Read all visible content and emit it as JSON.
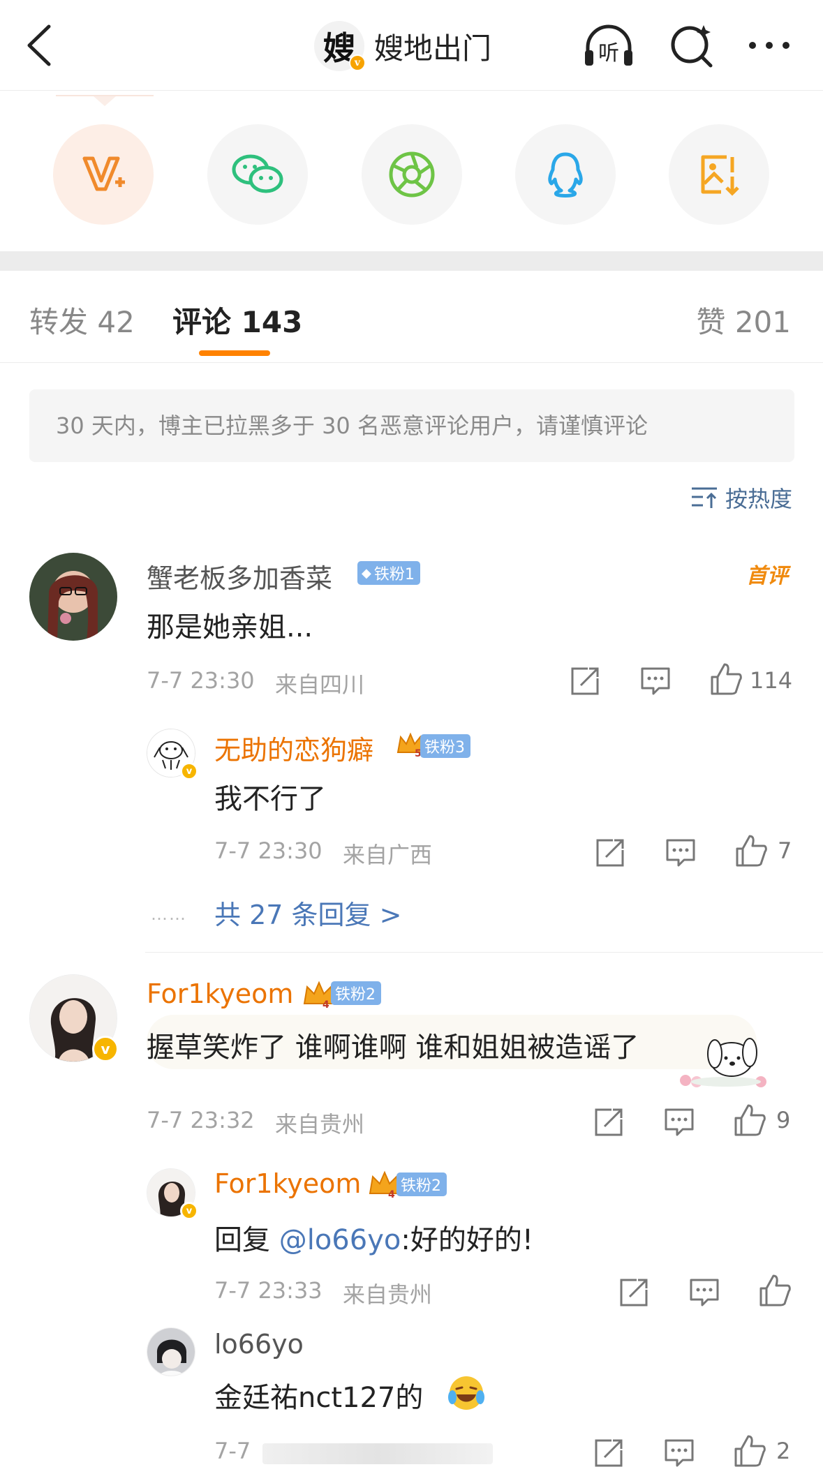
{
  "header": {
    "title": "嫂地出门",
    "avatar_glyph": "嫂",
    "verified_mark": "v",
    "icons": [
      "back-arrow-icon",
      "listen-icon",
      "search-icon",
      "more-icon"
    ],
    "listen_label": "听"
  },
  "share": {
    "items": [
      "v-plus-icon",
      "wechat-icon",
      "moments-icon",
      "qq-icon",
      "save-image-icon"
    ]
  },
  "tabs": {
    "repost": "转发 42",
    "comment": "评论 143",
    "like": "赞 201",
    "accent": "#ff8200"
  },
  "notice": "30 天内，博主已拉黑多于 30 名恶意评论用户，请谨慎评论",
  "sort_label": "按热度",
  "comments": [
    {
      "user": "蟹老板多加香菜",
      "badge": "铁粉1",
      "first_label": "首评",
      "text": "那是她亲姐...",
      "time": "7-7 23:30",
      "location": "来自四川",
      "likes": "114",
      "replies": [
        {
          "user": "无助的恋狗癖",
          "badge": "铁粉3",
          "crown_level": "5",
          "text": "我不行了",
          "time": "7-7 23:30",
          "location": "来自广西",
          "likes": "7"
        }
      ],
      "more_replies": "共 27 条回复 >",
      "dots": "……"
    },
    {
      "user": "For1kyeom",
      "badge": "铁粉2",
      "crown_level": "4",
      "text": "握草笑炸了 谁啊谁啊 谁和姐姐被造谣了",
      "time": "7-7 23:32",
      "location": "来自贵州",
      "likes": "9",
      "replies": [
        {
          "user": "For1kyeom",
          "badge": "铁粉2",
          "crown_level": "4",
          "text_prefix": "回复 ",
          "mention": "@lo66yo",
          "text_suffix": ":好的好的!",
          "time": "7-7 23:33",
          "location": "来自贵州",
          "likes": ""
        },
        {
          "user": "lo66yo",
          "text": "金廷祐nct127的",
          "time": "7-7",
          "likes": "2"
        }
      ]
    }
  ]
}
